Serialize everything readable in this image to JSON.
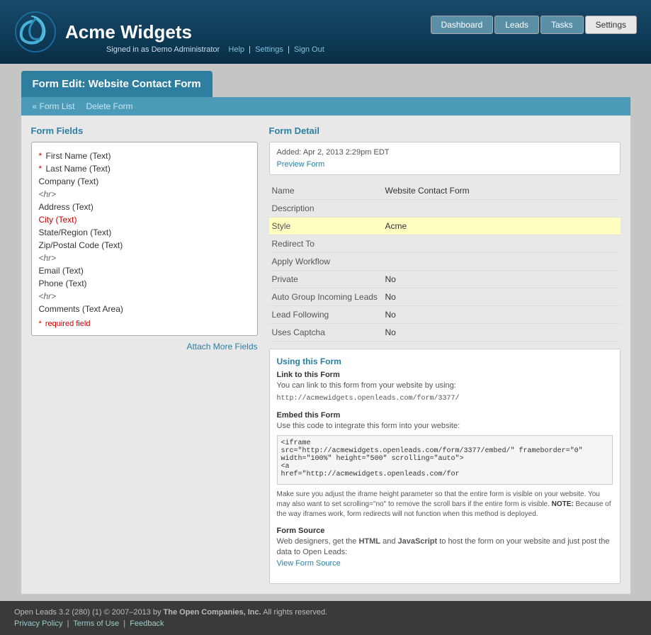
{
  "app": {
    "title": "Acme Widgets",
    "user_info": "Signed in as Demo Administrator",
    "help_link": "Help",
    "settings_link": "Settings",
    "signout_link": "Sign Out"
  },
  "nav": {
    "buttons": [
      {
        "label": "Dashboard",
        "active": false
      },
      {
        "label": "Leads",
        "active": false
      },
      {
        "label": "Tasks",
        "active": false
      },
      {
        "label": "Settings",
        "active": true
      }
    ]
  },
  "page": {
    "tab_title": "Form Edit: Website Contact Form",
    "breadcrumb_form_list": "« Form List",
    "breadcrumb_delete": "Delete Form"
  },
  "form_fields": {
    "section_title": "Form Fields",
    "fields": [
      {
        "label": "First Name (Text)",
        "required": true
      },
      {
        "label": "Last Name (Text)",
        "required": true
      },
      {
        "label": "Company (Text)",
        "required": false
      },
      {
        "label": "<hr>",
        "type": "divider"
      },
      {
        "label": "Address (Text)",
        "required": false
      },
      {
        "label": "City (Text)",
        "required": false,
        "highlight": true
      },
      {
        "label": "State/Region (Text)",
        "required": false
      },
      {
        "label": "Zip/Postal Code (Text)",
        "required": false
      },
      {
        "label": "<hr>",
        "type": "divider"
      },
      {
        "label": "Email (Text)",
        "required": false
      },
      {
        "label": "Phone (Text)",
        "required": false
      },
      {
        "label": "<hr>",
        "type": "divider"
      },
      {
        "label": "Comments (Text Area)",
        "required": false
      }
    ],
    "required_note": "* required field",
    "attach_more": "Attach More Fields"
  },
  "form_detail": {
    "section_title": "Form Detail",
    "added_text": "Added: Apr 2, 2013 2:29pm EDT",
    "preview_link": "Preview Form",
    "fields": [
      {
        "label": "Name",
        "value": "Website Contact Form"
      },
      {
        "label": "Description",
        "value": ""
      },
      {
        "label": "Style",
        "value": "Acme",
        "highlight": true
      },
      {
        "label": "Redirect To",
        "value": ""
      },
      {
        "label": "Apply Workflow",
        "value": ""
      },
      {
        "label": "Private",
        "value": "No"
      },
      {
        "label": "Auto Group Incoming Leads",
        "value": "No"
      },
      {
        "label": "Lead Following",
        "value": "No"
      },
      {
        "label": "Uses Captcha",
        "value": "No"
      }
    ]
  },
  "using_form": {
    "section_title": "Using this Form",
    "link_section": {
      "title": "Link to this Form",
      "description": "You can link to this form from your website by using:",
      "url": "http://acmewidgets.openleads.com/form/3377/"
    },
    "embed_section": {
      "title": "Embed this Form",
      "description": "Use this code to integrate this form into your website:",
      "code": "<iframe\nsrc=\"http://acmewidgets.openleads.com/form/3377/embed/\" frameborder=\"0\"\nwidth=\"100%\" height=\"500\" scrolling=\"auto\">\n<a\nhref=\"http://acmewidgets.openleads.com/for",
      "note": "Make sure you adjust the iframe height parameter so that the entire form is visible on your website. You may also want to set scrolling=\"no\" to remove the scroll bars if the entire form is visible. NOTE: Because of the way iframes work, form redirects will not function when this method is deployed."
    },
    "form_source": {
      "title": "Form Source",
      "description": "Web designers, get the HTML and JavaScript to host the form on your website and just post the data to Open Leads:",
      "link_label": "View Form Source"
    }
  },
  "footer": {
    "copyright": "Open Leads 3.2 (280) (1) © 2007–2013 by ",
    "company": "The Open Companies, Inc.",
    "rights": " All rights reserved.",
    "privacy": "Privacy Policy",
    "terms": "Terms of Use",
    "feedback": "Feedback"
  }
}
